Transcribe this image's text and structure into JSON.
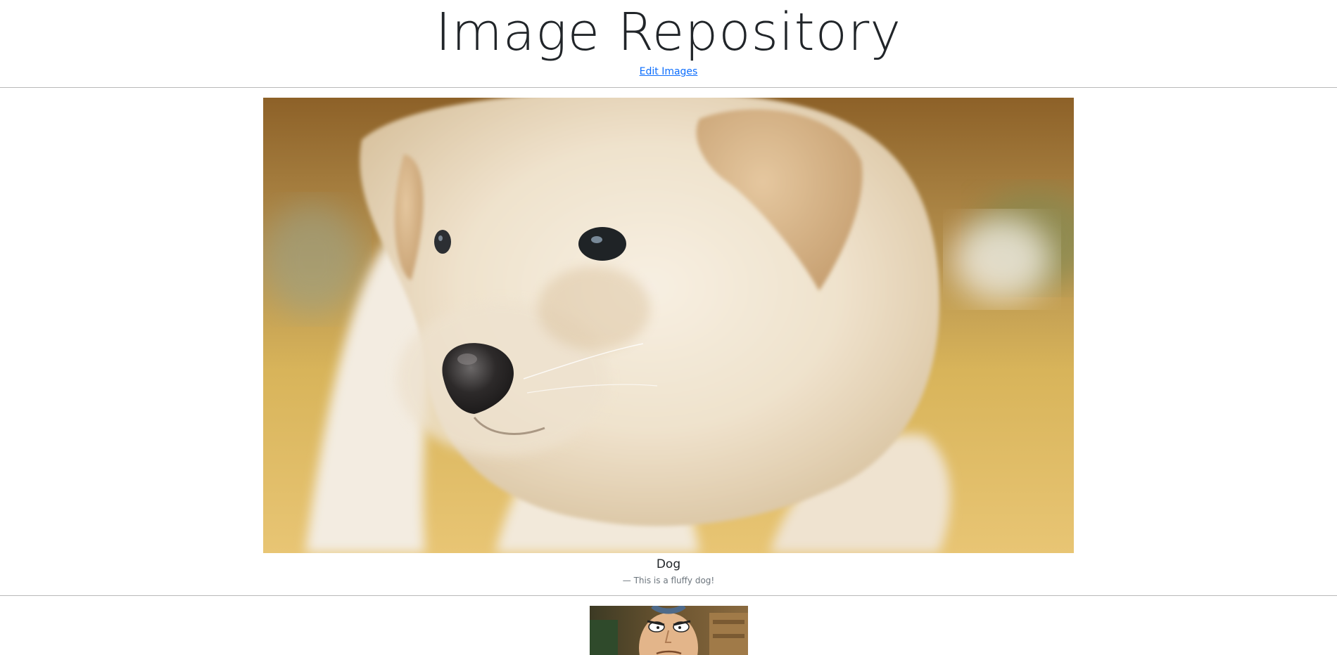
{
  "header": {
    "title": "Image Repository",
    "edit_link": "Edit Images"
  },
  "gallery": [
    {
      "image_icon": "puppy-photo",
      "title": "Dog",
      "description": "— This is a fluffy dog!"
    },
    {
      "image_icon": "cartoon-character-photo"
    }
  ],
  "colors": {
    "link": "#0d6efd",
    "divider": "#b9b9b9",
    "muted_text": "#6c757d"
  }
}
